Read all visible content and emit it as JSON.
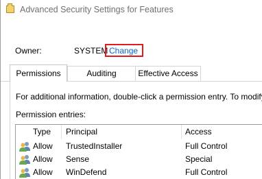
{
  "window": {
    "title": "Advanced Security Settings for Features"
  },
  "owner": {
    "label": "Owner:",
    "value": "SYSTEM",
    "change_link": "Change",
    "highlight_color": "#e01b1b",
    "link_color": "#0b63c4"
  },
  "tabs": [
    {
      "label": "Permissions",
      "active": true
    },
    {
      "label": "Auditing",
      "active": false
    },
    {
      "label": "Effective Access",
      "active": false
    }
  ],
  "info_text": "For additional information, double-click a permission entry. To modify",
  "entries_label": "Permission entries:",
  "table": {
    "columns": [
      "Type",
      "Principal",
      "Access"
    ],
    "rows": [
      {
        "icon": "users-icon",
        "type": "Allow",
        "principal": "TrustedInstaller",
        "access": "Full Control"
      },
      {
        "icon": "users-icon",
        "type": "Allow",
        "principal": "Sense",
        "access": "Special"
      },
      {
        "icon": "users-icon",
        "type": "Allow",
        "principal": "WinDefend",
        "access": "Full Control"
      }
    ]
  }
}
